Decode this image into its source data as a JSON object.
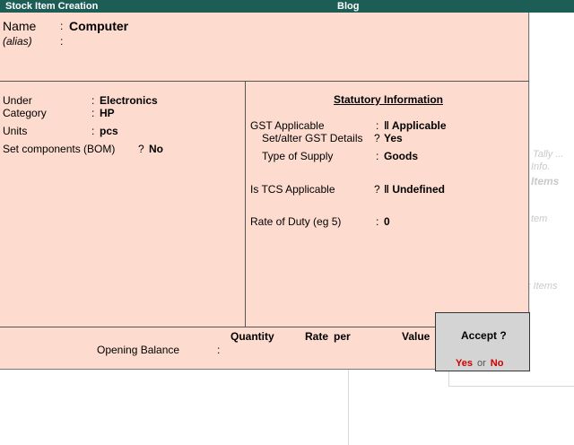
{
  "titlebar": {
    "left_title": "Stock Item Creation",
    "center_title": "Blog"
  },
  "name": {
    "label": "Name",
    "value": "Computer"
  },
  "alias": {
    "label": "(alias)"
  },
  "left": {
    "under": {
      "label": "Under",
      "value": "Electronics"
    },
    "category": {
      "label": "Category",
      "value": "HP"
    },
    "units": {
      "label": "Units",
      "value": "pcs"
    },
    "bom": {
      "label": "Set components (BOM)",
      "value": "No"
    }
  },
  "statutory": {
    "title": "Statutory Information",
    "gst_applicable": {
      "label": "GST Applicable",
      "value": "Applicable"
    },
    "gst_details": {
      "label": "Set/alter GST Details",
      "value": "Yes"
    },
    "supply": {
      "label": "Type of Supply",
      "value": "Goods"
    },
    "tcs": {
      "label": "Is TCS Applicable",
      "value": "Undefined"
    },
    "rate": {
      "label": "Rate of Duty (eg 5)",
      "value": "0"
    }
  },
  "opening": {
    "label": "Opening Balance",
    "headers": {
      "quantity": "Quantity",
      "rate": "Rate",
      "per": "per",
      "value": "Value"
    }
  },
  "accept": {
    "question": "Accept ?",
    "yes": "Yes",
    "or": "or",
    "no": "No"
  },
  "background_ghost": {
    "tally": "Tally ...",
    "info": "Info.",
    "items": "Items",
    "item": "tem",
    "k_items": "k Items"
  }
}
